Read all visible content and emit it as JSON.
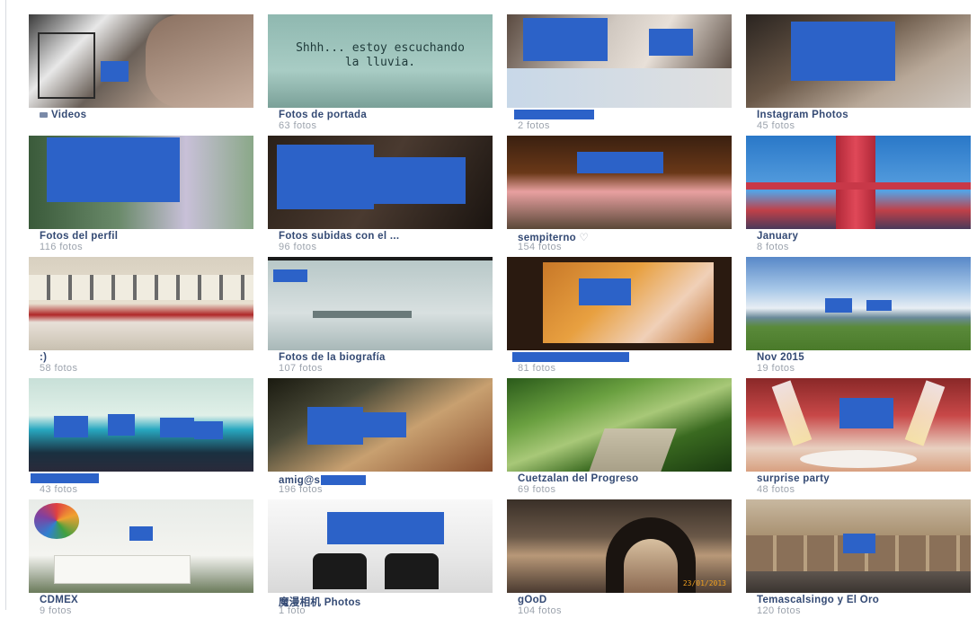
{
  "albums": [
    {
      "title": "Videos",
      "count": "",
      "has_video_icon": true
    },
    {
      "title": "Fotos de portada",
      "count": "63 fotos",
      "thumb_text": "Shhh... estoy escuchando la lluvia."
    },
    {
      "title": "",
      "count": "2 fotos"
    },
    {
      "title": "Instagram Photos",
      "count": "45 fotos"
    },
    {
      "title": "Fotos del perfil",
      "count": "116 fotos"
    },
    {
      "title": "Fotos subidas con el ...",
      "count": "96 fotos"
    },
    {
      "title": "sempiterno",
      "count": "154 fotos",
      "title_suffix": "♡"
    },
    {
      "title": "January",
      "count": "8 fotos"
    },
    {
      "title": ":)",
      "count": "58 fotos"
    },
    {
      "title": "Fotos de la biografía",
      "count": "107 fotos"
    },
    {
      "title": "",
      "count": "81 fotos"
    },
    {
      "title": "Nov 2015",
      "count": "19 fotos"
    },
    {
      "title": "",
      "count": "43 fotos"
    },
    {
      "title": "amig@s",
      "count": "196 fotos"
    },
    {
      "title": "Cuetzalan del Progreso",
      "count": "69 fotos"
    },
    {
      "title": "surprise party",
      "count": "48 fotos"
    },
    {
      "title": "CDMEX",
      "count": "9 fotos"
    },
    {
      "title": "魔漫相机 Photos",
      "count": "1 foto"
    },
    {
      "title": "gOoD",
      "count": "104 fotos",
      "thumb_stamp": "23/01/2013"
    },
    {
      "title": "Temascalsingo y El Oro",
      "count": "120 fotos"
    }
  ],
  "colors": {
    "title": "#344a74",
    "count": "#9ca3ad",
    "redaction": "#2c62c8"
  }
}
